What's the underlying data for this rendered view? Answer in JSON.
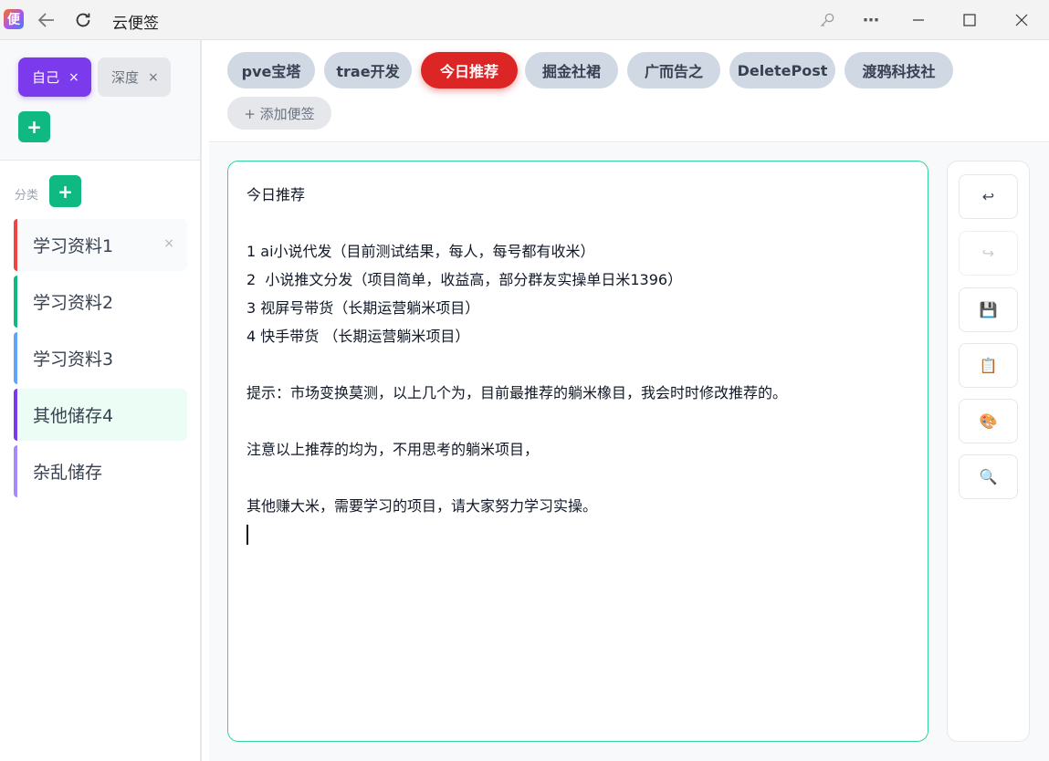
{
  "app": {
    "logo_text": "便",
    "title": "云便签"
  },
  "workspaces": {
    "tabs": [
      {
        "label": "自己",
        "close": "×"
      },
      {
        "label": "深度",
        "close": "×"
      }
    ],
    "add_label": "+"
  },
  "categories": {
    "header": "分类",
    "add_label": "+",
    "items": [
      {
        "label": "学习资料1",
        "color": "#ef4444",
        "close": "×"
      },
      {
        "label": "学习资料2",
        "color": "#10b981"
      },
      {
        "label": "学习资料3",
        "color": "#60a5fa"
      },
      {
        "label": "其他储存4",
        "color": "#7c3aed"
      },
      {
        "label": "杂乱储存",
        "color": "#a78bfa"
      }
    ]
  },
  "notes": {
    "tabs": [
      "pve宝塔",
      "trae开发",
      "今日推荐",
      "掘金社裙",
      "广而告之",
      "DeletePost",
      "渡鸦科技社"
    ],
    "active_index": 2,
    "add_label": "+ 添加便签"
  },
  "editor": {
    "lines": [
      "今日推荐",
      "",
      "1 ai小说代发（目前测试结果，每人，每号都有收米）",
      "2  小说推文分发（项目简单，收益高，部分群友实操单日米1396）",
      "3 视屏号带货（长期运营躺米项目）",
      "4 快手带货 （长期运营躺米项目）",
      "",
      "提示：市场变换莫测，以上几个为，目前最推荐的躺米橡目，我会时时修改推荐的。",
      "",
      "注意以上推荐的均为，不用思考的躺米项目，",
      "",
      "其他赚大米，需要学习的项目，请大家努力学习实操。"
    ]
  },
  "toolbar": {
    "undo": "↩",
    "redo": "↪",
    "save": "💾",
    "paste": "📋",
    "color": "🎨",
    "search": "🔍"
  },
  "colors": {
    "workspace_active": "#7c3aed",
    "note_active": "#dc2626",
    "add_green": "#10b981",
    "editor_border": "#34d399"
  }
}
